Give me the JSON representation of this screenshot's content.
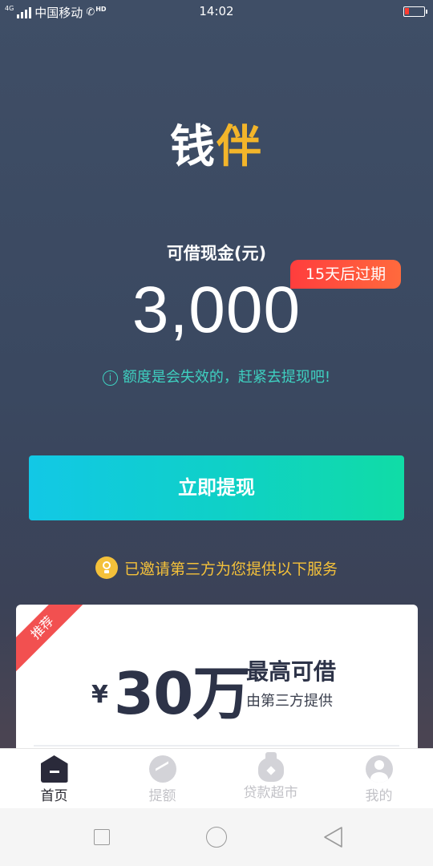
{
  "status_bar": {
    "network_badge": "4G",
    "carrier": "中国移动",
    "hd_badge": "HD",
    "time": "14:02",
    "battery_color": "#ff3b30"
  },
  "logo": {
    "char_1": "钱",
    "char_2": "伴",
    "accent_color": "#f3b52a"
  },
  "loan": {
    "label": "可借现金(元)",
    "amount": "3,000",
    "expire_badge": "15天后过期",
    "tip": "额度是会失效的，赶紧去提现吧!",
    "tip_icon": "info-icon"
  },
  "withdraw_button": {
    "label": "立即提现"
  },
  "third_party": {
    "tip": "已邀请第三方为您提供以下服务",
    "icon": "bulb-icon"
  },
  "promo_card": {
    "ribbon": "推荐",
    "currency": "¥",
    "limit_value": "30万",
    "limit_title": "最高可借",
    "limit_sub": "由第三方提供"
  },
  "tab_bar": {
    "items": [
      {
        "label": "首页",
        "icon": "home-icon",
        "active": true
      },
      {
        "label": "提额",
        "icon": "trend-icon",
        "active": false
      },
      {
        "label": "贷款超市",
        "icon": "bag-icon",
        "active": false
      },
      {
        "label": "我的",
        "icon": "user-icon",
        "active": false
      }
    ]
  }
}
